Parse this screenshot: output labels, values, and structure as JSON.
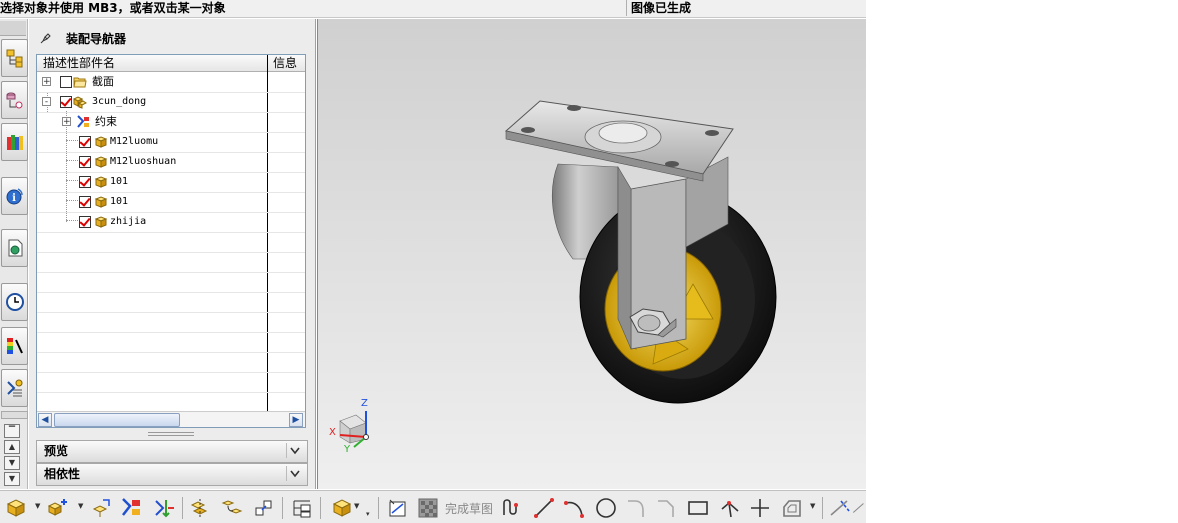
{
  "status": {
    "prompt": "选择对象并使用 MB3，或者双击某一对象",
    "message": "图像已生成"
  },
  "navigator": {
    "title": "装配导航器",
    "columns": [
      "描述性部件名",
      "信息"
    ],
    "rows": [
      {
        "label": "截面",
        "expander": "+",
        "checked": false,
        "icon": "folder-icon"
      },
      {
        "label": "3cun_dong",
        "expander": "-",
        "checked": true,
        "icon": "assembly-icon"
      },
      {
        "label": "约束",
        "expander": "+",
        "checked": null,
        "icon": "constraint-icon"
      },
      {
        "label": "M12luomu",
        "checked": true,
        "icon": "component-icon"
      },
      {
        "label": "M12luoshuan",
        "checked": true,
        "icon": "component-icon"
      },
      {
        "label": "101",
        "checked": true,
        "icon": "component-icon"
      },
      {
        "label": "101",
        "checked": true,
        "icon": "component-icon"
      },
      {
        "label": "zhijia",
        "checked": true,
        "icon": "component-icon"
      }
    ],
    "sections": [
      "预览",
      "相依性"
    ]
  },
  "triad": {
    "x": "X",
    "y": "Y",
    "z": "Z"
  },
  "toolbar": {
    "finish_sketch_label": "完成草图"
  },
  "colors": {
    "wheel_hub": "#e8c21a",
    "tire": "#1a1a1a",
    "steel": "#b8b8b8",
    "check": "#d00000"
  }
}
